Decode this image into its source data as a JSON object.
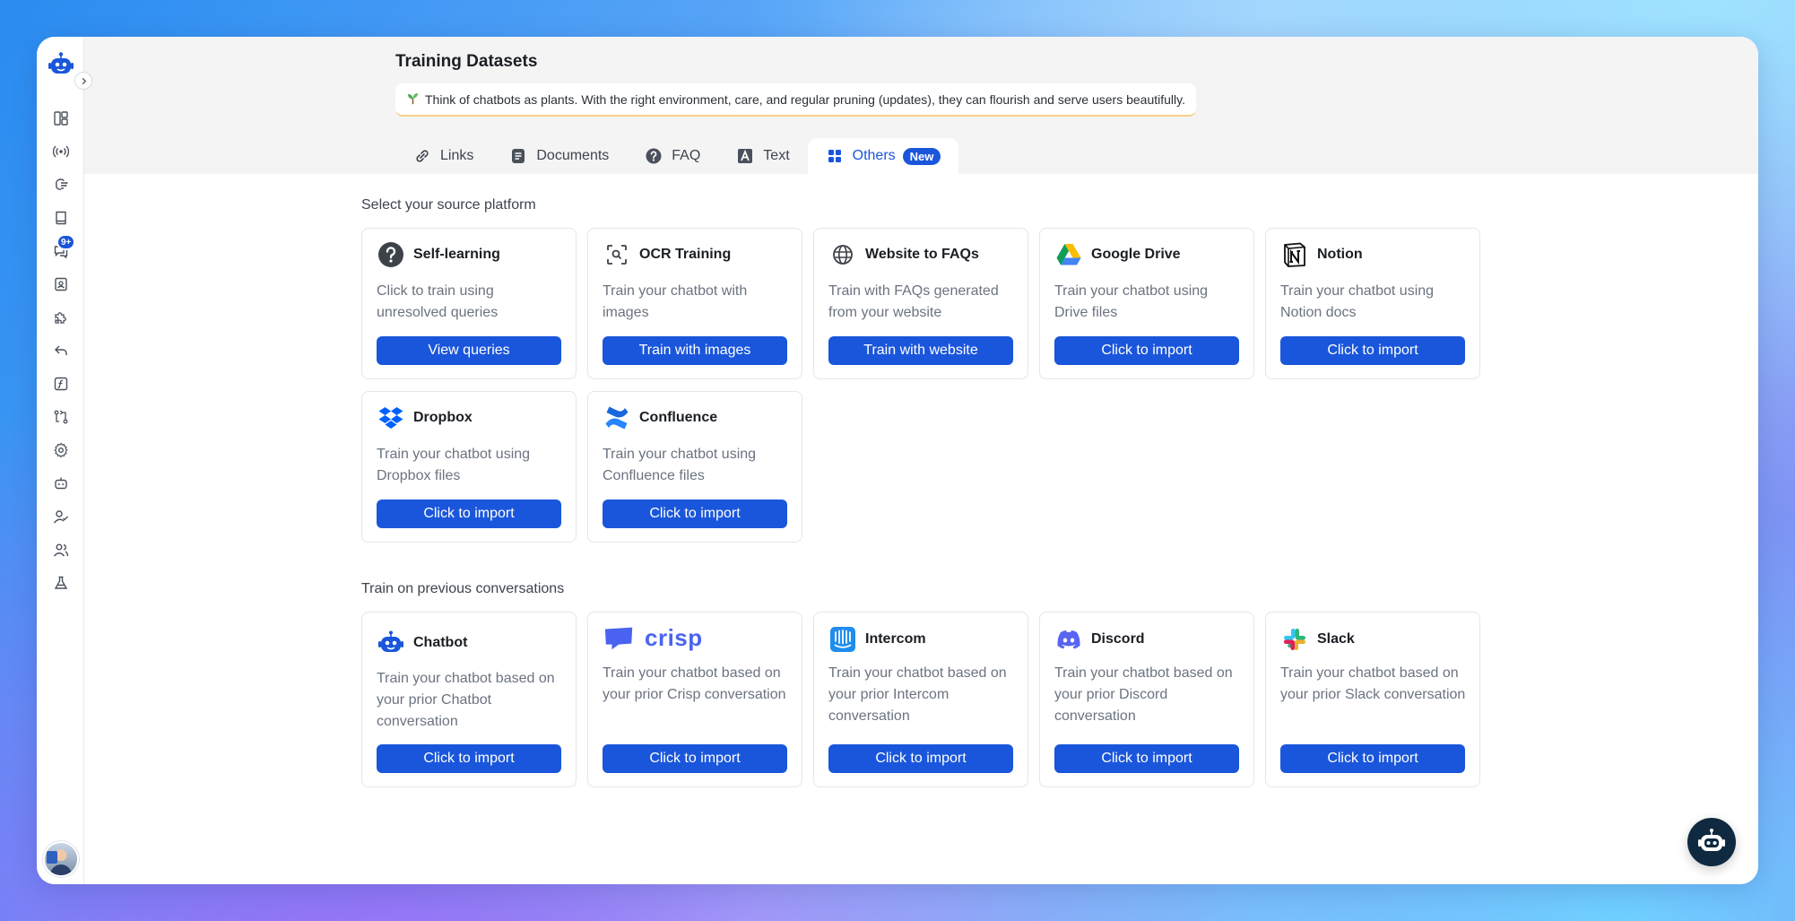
{
  "page": {
    "title": "Training Datasets",
    "tip": "Think of chatbots as plants. With the right environment, care, and regular pruning (updates), they can flourish and serve users beautifully."
  },
  "sidebar": {
    "badge": "9+",
    "items": [
      "dashboard-icon",
      "broadcast-icon",
      "brain-icon",
      "book-icon",
      "chat-icon",
      "contact-card-icon",
      "puzzle-icon",
      "reply-icon",
      "function-icon",
      "flow-icon",
      "gear-icon",
      "bot-icon",
      "user-check-icon",
      "users-icon",
      "flask-icon"
    ]
  },
  "tabs": [
    {
      "label": "Links",
      "icon": "link-icon"
    },
    {
      "label": "Documents",
      "icon": "document-icon"
    },
    {
      "label": "FAQ",
      "icon": "question-icon"
    },
    {
      "label": "Text",
      "icon": "text-icon"
    },
    {
      "label": "Others",
      "icon": "grid-icon",
      "badge": "New",
      "active": true
    }
  ],
  "sections": {
    "source_title": "Select your source platform",
    "previous_title": "Train on previous conversations"
  },
  "sources": [
    {
      "name": "Self-learning",
      "desc": "Click to train using unresolved queries",
      "button": "View queries"
    },
    {
      "name": "OCR Training",
      "desc": "Train your chatbot with images",
      "button": "Train with images"
    },
    {
      "name": "Website to FAQs",
      "desc": "Train with FAQs generated from your website",
      "button": "Train with website"
    },
    {
      "name": "Google Drive",
      "desc": "Train your chatbot using Drive files",
      "button": "Click to import"
    },
    {
      "name": "Notion",
      "desc": "Train your chatbot using Notion docs",
      "button": "Click to import"
    },
    {
      "name": "Dropbox",
      "desc": "Train your chatbot using Dropbox files",
      "button": "Click to import"
    },
    {
      "name": "Confluence",
      "desc": "Train your chatbot using Confluence files",
      "button": "Click to import"
    }
  ],
  "previous": [
    {
      "name": "Chatbot",
      "desc": "Train your chatbot based on your prior Chatbot conversation",
      "button": "Click to import"
    },
    {
      "name": "crisp",
      "desc": "Train your chatbot based on your prior Crisp conversation",
      "button": "Click to import"
    },
    {
      "name": "Intercom",
      "desc": "Train your chatbot based on your prior Intercom conversation",
      "button": "Click to import"
    },
    {
      "name": "Discord",
      "desc": "Train your chatbot based on your prior Discord conversation",
      "button": "Click to import"
    },
    {
      "name": "Slack",
      "desc": "Train your chatbot based on your prior Slack conversation",
      "button": "Click to import"
    }
  ],
  "colors": {
    "accent": "#1a56db",
    "tab_background": "#f4f4f4"
  }
}
